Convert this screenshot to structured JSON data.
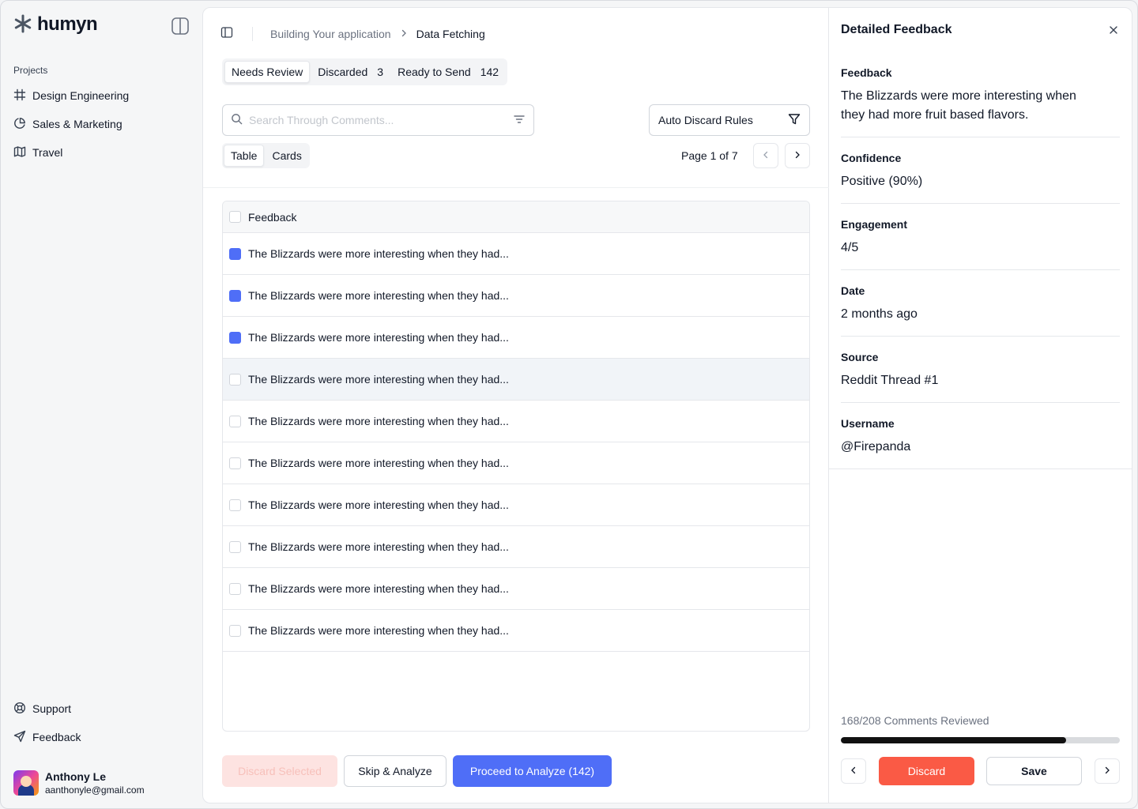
{
  "brand": {
    "name": "humyn",
    "logo_icon": "asterisk-icon"
  },
  "sidebar": {
    "section_label": "Projects",
    "projects": [
      {
        "label": "Design Engineering",
        "icon": "frame-icon"
      },
      {
        "label": "Sales & Marketing",
        "icon": "pie-chart-icon"
      },
      {
        "label": "Travel",
        "icon": "map-icon"
      }
    ],
    "footer_links": [
      {
        "label": "Support",
        "icon": "life-buoy-icon"
      },
      {
        "label": "Feedback",
        "icon": "send-icon"
      }
    ],
    "user": {
      "name": "Anthony Le",
      "email": "aanthonyle@gmail.com"
    }
  },
  "breadcrumb": {
    "parent": "Building Your application",
    "separator": ">",
    "current": "Data Fetching"
  },
  "tabs": [
    {
      "label": "Needs Review",
      "count": "",
      "active": true
    },
    {
      "label": "Discarded",
      "count": "3",
      "active": false
    },
    {
      "label": "Ready to Send",
      "count": "142",
      "active": false
    }
  ],
  "search": {
    "placeholder": "Search Through Comments...",
    "value": ""
  },
  "auto_discard": {
    "label": "Auto Discard Rules"
  },
  "view_toggle": {
    "table": "Table",
    "cards": "Cards",
    "active": "Table"
  },
  "pagination": {
    "label": "Page 1 of 7"
  },
  "table": {
    "header": "Feedback",
    "rows": [
      {
        "text": "The Blizzards were more interesting when they had...",
        "checked": true,
        "highlighted": false
      },
      {
        "text": "The Blizzards were more interesting when they had...",
        "checked": true,
        "highlighted": false
      },
      {
        "text": "The Blizzards were more interesting when they had...",
        "checked": true,
        "highlighted": false
      },
      {
        "text": "The Blizzards were more interesting when they had...",
        "checked": false,
        "highlighted": true
      },
      {
        "text": "The Blizzards were more interesting when they had...",
        "checked": false,
        "highlighted": false
      },
      {
        "text": "The Blizzards were more interesting when they had...",
        "checked": false,
        "highlighted": false
      },
      {
        "text": "The Blizzards were more interesting when they had...",
        "checked": false,
        "highlighted": false
      },
      {
        "text": "The Blizzards were more interesting when they had...",
        "checked": false,
        "highlighted": false
      },
      {
        "text": "The Blizzards were more interesting when they had...",
        "checked": false,
        "highlighted": false
      },
      {
        "text": "The Blizzards were more interesting when they had...",
        "checked": false,
        "highlighted": false
      }
    ]
  },
  "actions": {
    "discard_selected": "Discard Selected",
    "skip_analyze": "Skip & Analyze",
    "proceed": "Proceed to Analyze (142)"
  },
  "detail": {
    "title": "Detailed Feedback",
    "fields": [
      {
        "label": "Feedback",
        "value": "The Blizzards were more interesting when they had more fruit based flavors."
      },
      {
        "label": "Confidence",
        "value": "Positive (90%)"
      },
      {
        "label": "Engagement",
        "value": "4/5"
      },
      {
        "label": "Date",
        "value": "2 months ago"
      },
      {
        "label": "Source",
        "value": "Reddit Thread #1"
      },
      {
        "label": "Username",
        "value": "@Firepanda"
      }
    ],
    "progress_text": "168/208 Comments Reviewed",
    "progress_fraction": 0.8077,
    "discard": "Discard",
    "save": "Save"
  },
  "colors": {
    "accent": "#4f6ef7",
    "danger": "#fa5a45",
    "progress": "#111111"
  }
}
